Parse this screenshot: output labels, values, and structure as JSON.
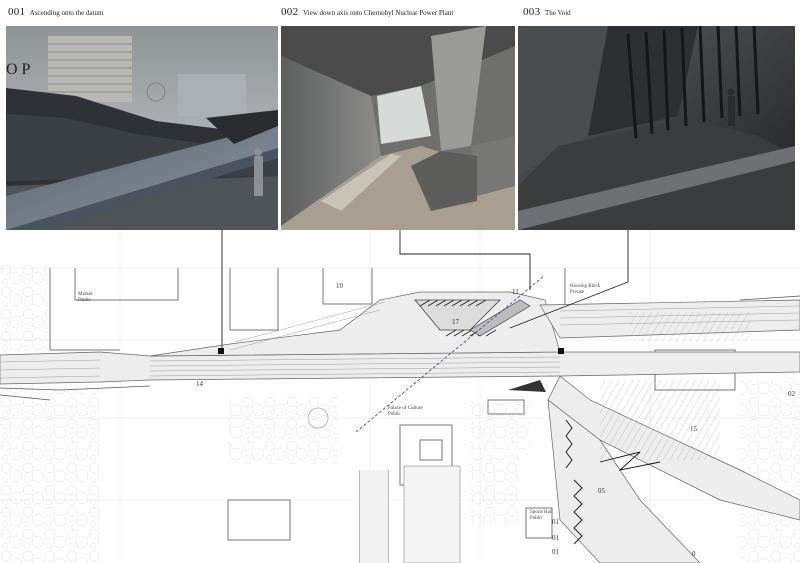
{
  "panels": [
    {
      "num": "001",
      "title": "Ascending onto the datum"
    },
    {
      "num": "002",
      "title": "View down axis onto Chernobyl Nuclear Power Plant"
    },
    {
      "num": "003",
      "title": "The Void"
    }
  ],
  "overlay_letters": "O P",
  "plan": {
    "labels": {
      "market": [
        "Market",
        "Public"
      ],
      "housing": [
        "Housing Block",
        "Private"
      ],
      "palace": [
        "Palace of Culture",
        "Public"
      ],
      "sports": [
        "Sports Hall",
        "Public"
      ]
    },
    "numbers": [
      "10",
      "11",
      "17",
      "14",
      "15",
      "05",
      "01",
      "01",
      "01",
      "02",
      "0"
    ]
  }
}
